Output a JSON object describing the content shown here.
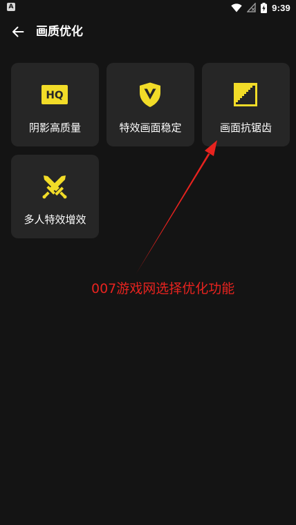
{
  "status_bar": {
    "left_icon_glyph": "A",
    "icons": [
      "wifi-icon",
      "signal-off-icon",
      "battery-charging-icon"
    ],
    "time": "9:39"
  },
  "header": {
    "back_icon": "arrow-left-icon",
    "title": "画质优化"
  },
  "cards": [
    {
      "label": "阴影高质量",
      "icon": "hq-icon",
      "icon_text": "HQ"
    },
    {
      "label": "特效画面稳定",
      "icon": "shield-v-icon"
    },
    {
      "label": "画面抗锯齿",
      "icon": "antialias-staircase-icon"
    },
    {
      "label": "多人特效增效",
      "icon": "crossed-swords-icon"
    }
  ],
  "annotation": {
    "text": "007游戏网选择优化功能",
    "color": "#e8231f"
  },
  "colors": {
    "background": "#141414",
    "card": "#262626",
    "accent": "#f2dc28",
    "annotation": "#e8231f"
  }
}
